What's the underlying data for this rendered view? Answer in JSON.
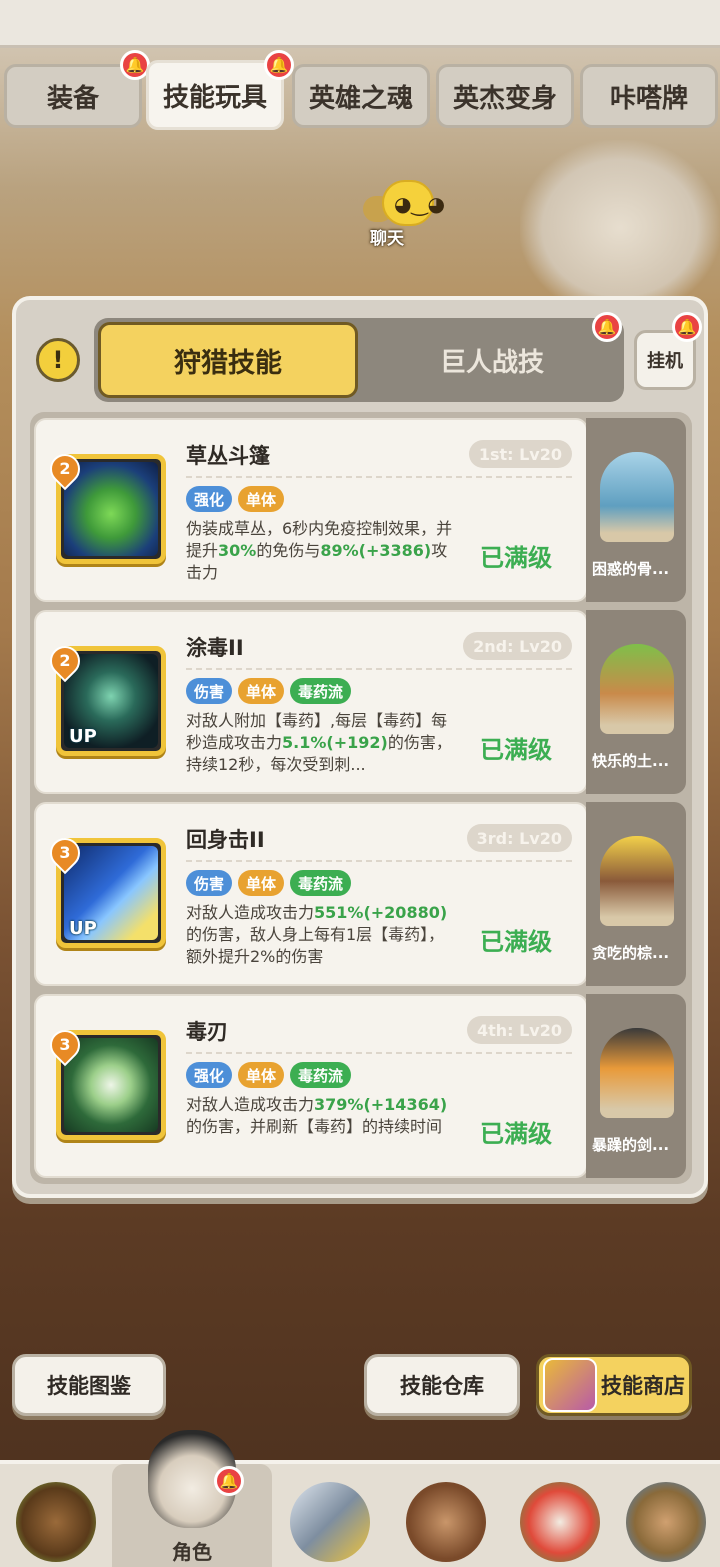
{
  "tabs": [
    {
      "label": "装备",
      "badge": true
    },
    {
      "label": "技能玩具",
      "badge": true,
      "active": true
    },
    {
      "label": "英雄之魂",
      "badge": false
    },
    {
      "label": "英杰变身",
      "badge": false
    },
    {
      "label": "咔嗒牌",
      "badge": false
    }
  ],
  "chat": {
    "label": "聊天"
  },
  "segment": {
    "hunt": "狩猎技能",
    "giant": "巨人战技"
  },
  "idle_label": "挂机",
  "skills": [
    {
      "rank": "2",
      "name": "草丛斗篷",
      "level": "1st: Lv20",
      "up": false,
      "tags": [
        {
          "t": "强化",
          "c": "blue"
        },
        {
          "t": "单体",
          "c": "orange"
        }
      ],
      "desc_parts": [
        "伪装成草丛，6秒内免疫控制效果，并提升",
        "30%",
        "的免伤与",
        "89%",
        "(+3386)",
        "攻击力"
      ],
      "status": "已满级",
      "pet": "困惑的骨..."
    },
    {
      "rank": "2",
      "name": "涂毒II",
      "level": "2nd: Lv20",
      "up": true,
      "tags": [
        {
          "t": "伤害",
          "c": "blue"
        },
        {
          "t": "单体",
          "c": "orange"
        },
        {
          "t": "毒药流",
          "c": "green"
        }
      ],
      "desc_parts": [
        "对敌人附加【毒药】,每层【毒药】每秒造成攻击力",
        "5.1%",
        "(+192)",
        "的伤害，持续12秒，每次受到刺..."
      ],
      "status": "已满级",
      "pet": "快乐的土..."
    },
    {
      "rank": "3",
      "name": "回身击II",
      "level": "3rd: Lv20",
      "up": true,
      "tags": [
        {
          "t": "伤害",
          "c": "blue"
        },
        {
          "t": "单体",
          "c": "orange"
        },
        {
          "t": "毒药流",
          "c": "green"
        }
      ],
      "desc_parts": [
        "对敌人造成攻击力",
        "551%",
        "(+20880)",
        "的伤害，敌人身上每有1层【毒药】，额外提升2%的伤害"
      ],
      "status": "已满级",
      "pet": "贪吃的棕..."
    },
    {
      "rank": "3",
      "name": "毒刃",
      "level": "4th: Lv20",
      "up": false,
      "tags": [
        {
          "t": "强化",
          "c": "blue"
        },
        {
          "t": "单体",
          "c": "orange"
        },
        {
          "t": "毒药流",
          "c": "green"
        }
      ],
      "desc_parts": [
        "对敌人造成攻击力",
        "379%",
        "(+14364)",
        "的伤害，并刷新【毒药】的持续时间"
      ],
      "status": "已满级",
      "pet": "暴躁的剑..."
    }
  ],
  "bottom_buttons": {
    "codex": "技能图鉴",
    "warehouse": "技能仓库",
    "shop": "技能商店"
  },
  "nav": {
    "active_label": "角色"
  },
  "colors": {
    "accent_yellow": "#f4d25f",
    "green_text": "#3cae52",
    "badge_red": "#e94343"
  }
}
